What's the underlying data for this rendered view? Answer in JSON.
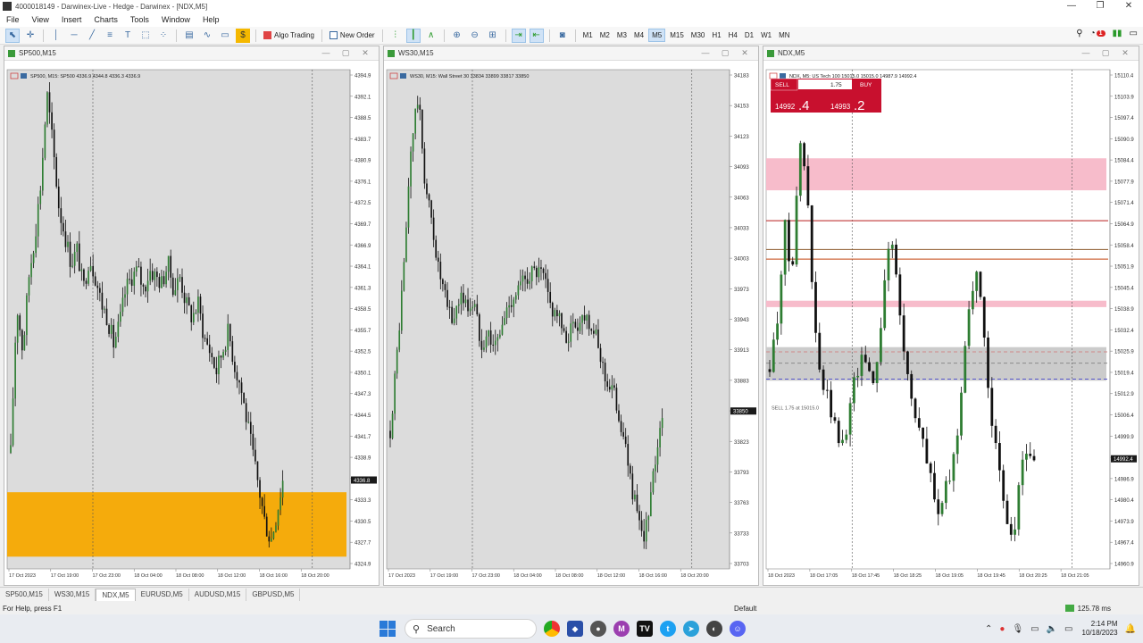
{
  "window": {
    "title": "4000018149 - Darwinex-Live - Hedge - Darwinex - [NDX,M5]",
    "controls": [
      "—",
      "❐",
      "✕"
    ]
  },
  "menu": [
    "File",
    "View",
    "Insert",
    "Charts",
    "Tools",
    "Window",
    "Help"
  ],
  "toolbar": {
    "algo_trading": "Algo Trading",
    "new_order": "New Order",
    "timeframes": [
      "M1",
      "M2",
      "M3",
      "M4",
      "M5",
      "M15",
      "M30",
      "H1",
      "H4",
      "D1",
      "W1",
      "MN"
    ],
    "active_timeframe": "M5",
    "notification_count": "1"
  },
  "panels": [
    {
      "title": "SP500,M15",
      "icon": "chart-window-icon"
    },
    {
      "title": "WS30,M15",
      "icon": "chart-window-icon"
    },
    {
      "title": "NDX,M5",
      "icon": "chart-window-icon"
    }
  ],
  "tabs": [
    "SP500,M15",
    "WS30,M15",
    "NDX,M5",
    "EURUSD,M5",
    "AUDUSD,M15",
    "GBPUSD,M5"
  ],
  "active_tab": "NDX,M5",
  "status": {
    "help": "For Help, press F1",
    "profile": "Default",
    "ping": "125.78 ms"
  },
  "taskbar": {
    "search": "Search",
    "time": "2:14 PM",
    "date": "10/18/2023"
  },
  "trade_panel": {
    "sell": "SELL",
    "buy": "BUY",
    "lot": "1.75",
    "bid_main": "14992",
    "bid_big": ".4",
    "ask_main": "14993",
    "ask_big": ".2"
  },
  "chart_data": [
    {
      "type": "candlestick",
      "symbol": "SP500,M15",
      "info": "SP500, M15:  SP500  4336.9 4344.8 4336.3 4336.9",
      "y_ticks": [
        "4394.9",
        "4392.1",
        "4388.5",
        "4383.7",
        "4380.9",
        "4376.1",
        "4372.5",
        "4369.7",
        "4366.9",
        "4364.1",
        "4361.3",
        "4358.5",
        "4355.7",
        "4352.5",
        "4350.1",
        "4347.3",
        "4344.5",
        "4341.7",
        "4338.9",
        "4336.1",
        "4333.3",
        "4330.5",
        "4327.7",
        "4324.9"
      ],
      "current_price": "4336.8",
      "x_ticks": [
        "17 Oct 2023",
        "17 Oct 19:00",
        "17 Oct 23:00",
        "18 Oct 04:00",
        "18 Oct 08:00",
        "18 Oct 12:00",
        "18 Oct 16:00",
        "18 Oct 20:00"
      ],
      "ylim": [
        4322.9,
        4396.5
      ],
      "close_path": [
        4340,
        4362,
        4355,
        4366,
        4372,
        4380,
        4393,
        4385,
        4376,
        4372,
        4368,
        4370,
        4364,
        4369,
        4366,
        4362,
        4360,
        4356,
        4359,
        4364,
        4366,
        4367,
        4364,
        4367,
        4366,
        4365,
        4368,
        4364,
        4366,
        4362,
        4360,
        4362,
        4357,
        4355,
        4352,
        4355,
        4358,
        4353,
        4350,
        4345,
        4340,
        4335,
        4330,
        4327,
        4331,
        4336
      ],
      "zones": [
        {
          "from": 4324.7,
          "to": 4334.2,
          "color": "#f5a800"
        }
      ]
    },
    {
      "type": "candlestick",
      "symbol": "WS30,M15",
      "info": "WS30, M15:  Wall Street 30  33834 33899 33817 33850",
      "y_ticks": [
        "34183",
        "34153",
        "34123",
        "34093",
        "34063",
        "34033",
        "34003",
        "33973",
        "33943",
        "33913",
        "33883",
        "33853",
        "33823",
        "33793",
        "33763",
        "33733",
        "33703"
      ],
      "current_price": "33850",
      "x_ticks": [
        "17 Oct 2023",
        "17 Oct 19:00",
        "17 Oct 23:00",
        "18 Oct 04:00",
        "18 Oct 08:00",
        "18 Oct 12:00",
        "18 Oct 16:00",
        "18 Oct 20:00"
      ],
      "ylim": [
        33690,
        34196
      ],
      "close_path": [
        33830,
        33910,
        34000,
        34120,
        34170,
        34080,
        34040,
        33990,
        33960,
        33940,
        33970,
        33955,
        33960,
        33920,
        33930,
        33915,
        33935,
        33960,
        33970,
        33980,
        33990,
        33990,
        33985,
        33955,
        33950,
        33920,
        33935,
        33940,
        33950,
        33935,
        33910,
        33880,
        33870,
        33840,
        33800,
        33760,
        33720,
        33740,
        33800,
        33850
      ],
      "zones": []
    },
    {
      "type": "candlestick",
      "symbol": "NDX,M5",
      "info": "NDX, M5:  US Tech 100  15015.0 15015.0 14987.9 14992.4",
      "y_ticks": [
        "15110.4",
        "15103.9",
        "15097.4",
        "15090.9",
        "15084.4",
        "15077.9",
        "15071.4",
        "15064.9",
        "15058.4",
        "15051.9",
        "15045.4",
        "15038.9",
        "15032.4",
        "15025.9",
        "15019.4",
        "15012.9",
        "15006.4",
        "14999.9",
        "14993.4",
        "14986.9",
        "14980.4",
        "14973.9",
        "14967.4",
        "14960.9"
      ],
      "current_price": "14992.4",
      "x_ticks": [
        "18 Oct 2023",
        "18 Oct 17:05",
        "18 Oct 17:45",
        "18 Oct 18:25",
        "18 Oct 19:05",
        "18 Oct 19:45",
        "18 Oct 20:25",
        "18 Oct 21:05"
      ],
      "ylim": [
        14957.6,
        15113.6
      ],
      "close_path": [
        15020,
        15035,
        15065,
        15050,
        15090,
        15080,
        15035,
        15015,
        15010,
        15000,
        14995,
        15012,
        15020,
        15025,
        15015,
        15030,
        15060,
        15055,
        15030,
        15015,
        15005,
        14995,
        14985,
        14975,
        14982,
        14990,
        15010,
        15040,
        15050,
        15035,
        15010,
        14990,
        14975,
        14965,
        14985,
        14995,
        14992
      ],
      "zones": [
        {
          "from": 15075.9,
          "to": 15085.9,
          "color": "#f7b8c8"
        },
        {
          "from": 15039.4,
          "to": 15041.4,
          "color": "#f7b8c8"
        },
        {
          "from": 15016.4,
          "to": 15026.9,
          "color": "#c8c8c8"
        }
      ],
      "lines": [
        {
          "y": 15054.4,
          "color": "#c2410c"
        },
        {
          "y": 15057.4,
          "color": "#8b5a2b"
        },
        {
          "y": 15066.4,
          "color": "#b91c1c"
        },
        {
          "y": 15016.9,
          "color": "#5555cc",
          "dash": true
        },
        {
          "y": 15025.4,
          "color": "#d08a8a",
          "dash": true
        },
        {
          "y": 15021.9,
          "color": "#8a8a8a",
          "dash": true
        }
      ],
      "order_label": "SELL 1.75 at 15015.0"
    }
  ]
}
